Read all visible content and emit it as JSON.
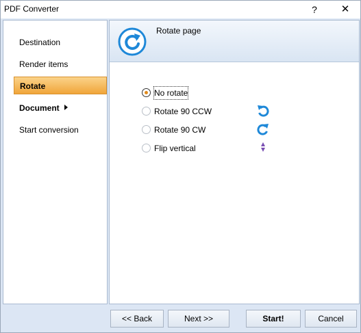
{
  "window": {
    "title": "PDF Converter",
    "help": "?",
    "close": "✕"
  },
  "sidebar": {
    "items": [
      {
        "label": "Destination"
      },
      {
        "label": "Render items"
      },
      {
        "label": "Rotate"
      },
      {
        "label": "Document"
      },
      {
        "label": "Start conversion"
      }
    ],
    "active": "Rotate"
  },
  "header": {
    "title": "Rotate page",
    "icon": "rotate-cw-icon"
  },
  "options": [
    {
      "label": "No rotate",
      "checked": true,
      "icon": ""
    },
    {
      "label": "Rotate 90 CCW",
      "checked": false,
      "icon": "rotate-ccw-icon"
    },
    {
      "label": "Rotate 90 CW",
      "checked": false,
      "icon": "rotate-cw-icon"
    },
    {
      "label": "Flip vertical",
      "checked": false,
      "icon": "flip-vertical-icon"
    }
  ],
  "buttons": {
    "back": "<< Back",
    "next": "Next >>",
    "start": "Start!",
    "cancel": "Cancel"
  },
  "colors": {
    "accent": "#f0a53a",
    "icon_blue": "#1e88d8",
    "flip_purple": "#7a4fb3"
  }
}
